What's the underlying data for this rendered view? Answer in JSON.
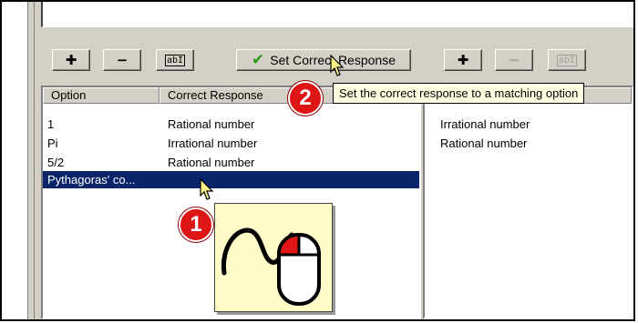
{
  "toolbar": {
    "add_symbol": "✚",
    "remove_symbol": "−",
    "rename_symbol": "abI",
    "set_correct_response_label": "Set Correct Response"
  },
  "options_list": {
    "columns": [
      "Option",
      "Correct Response"
    ],
    "rows": [
      {
        "option": "1",
        "response": "Rational number"
      },
      {
        "option": "Pi",
        "response": "Irrational number"
      },
      {
        "option": "5/2",
        "response": "Rational number"
      },
      {
        "option": "Pythagoras' co...",
        "response": ""
      }
    ],
    "selected_index": 3
  },
  "responses_list": {
    "items": [
      "Irrational number",
      "Rational number"
    ]
  },
  "tooltip": "Set the correct response to a matching option",
  "callouts": {
    "step1": "1",
    "step2": "2"
  },
  "colors": {
    "selection": "#0a246a",
    "callout": "#dd1515",
    "check": "#2c9a18",
    "tooltip_bg": "#ffffe1"
  }
}
